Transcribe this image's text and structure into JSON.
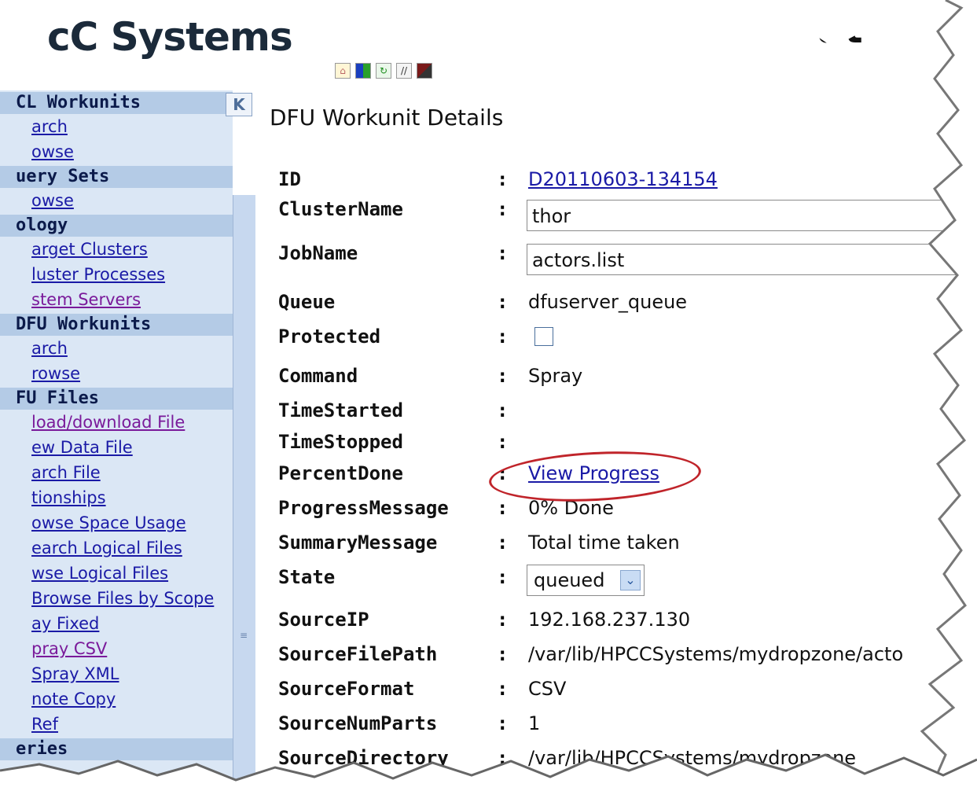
{
  "header": {
    "logo_text": "cC Systems",
    "logo_right_text": "at",
    "toolbar_icons": [
      "home-icon",
      "color-grid-icon",
      "refresh-icon",
      "edit-icon",
      "windows-icon"
    ]
  },
  "sidebar": {
    "collapse_label": "K",
    "sections": [
      {
        "title": "CL Workunits",
        "items": [
          {
            "label": "arch"
          },
          {
            "label": "owse"
          }
        ]
      },
      {
        "title": "uery Sets",
        "items": [
          {
            "label": "owse"
          }
        ]
      },
      {
        "title": "ology",
        "items": [
          {
            "label": "arget Clusters"
          },
          {
            "label": "luster Processes"
          },
          {
            "label": "stem Servers",
            "visited": true
          }
        ]
      },
      {
        "title": "DFU Workunits",
        "items": [
          {
            "label": "arch"
          },
          {
            "label": "rowse"
          }
        ]
      },
      {
        "title": "FU Files",
        "items": [
          {
            "label": "load/download File",
            "visited": true
          },
          {
            "label": "ew Data File"
          },
          {
            "label": "arch File"
          },
          {
            "label": "tionships"
          },
          {
            "label": "owse Space Usage"
          },
          {
            "label": "earch Logical Files"
          },
          {
            "label": "wse Logical Files"
          },
          {
            "label": "Browse Files by Scope"
          },
          {
            "label": "ay Fixed"
          },
          {
            "label": "pray CSV",
            "visited": true
          },
          {
            "label": "Spray XML"
          },
          {
            "label": "note Copy"
          },
          {
            "label": "Ref"
          }
        ]
      },
      {
        "title": "eries",
        "items": []
      }
    ]
  },
  "main": {
    "title": "DFU Workunit Details",
    "fields": [
      {
        "label": "ID",
        "value": "D20110603-134154",
        "kind": "link"
      },
      {
        "label": "ClusterName",
        "value": "thor",
        "kind": "textbox"
      },
      {
        "label": "JobName",
        "value": "actors.list",
        "kind": "textbox"
      },
      {
        "label": "Queue",
        "value": "dfuserver_queue",
        "kind": "text"
      },
      {
        "label": "Protected",
        "value": "",
        "kind": "checkbox"
      },
      {
        "label": "Command",
        "value": "Spray",
        "kind": "text"
      },
      {
        "label": "TimeStarted",
        "value": "",
        "kind": "text"
      },
      {
        "label": "TimeStopped",
        "value": "",
        "kind": "text"
      },
      {
        "label": "PercentDone",
        "value": "View Progress",
        "kind": "link"
      },
      {
        "label": "ProgressMessage",
        "value": "0% Done",
        "kind": "text"
      },
      {
        "label": "SummaryMessage",
        "value": "Total time taken",
        "kind": "text"
      },
      {
        "label": "State",
        "value": "queued",
        "kind": "select"
      },
      {
        "label": "SourceIP",
        "value": "192.168.237.130",
        "kind": "text"
      },
      {
        "label": "SourceFilePath",
        "value": "/var/lib/HPCCSystems/mydropzone/acto",
        "kind": "text"
      },
      {
        "label": "SourceFormat",
        "value": "CSV",
        "kind": "text"
      },
      {
        "label": "SourceNumParts",
        "value": "1",
        "kind": "text"
      },
      {
        "label": "SourceDirectory",
        "value": "/var/lib/HPCCSystems/mydropzone",
        "kind": "text"
      }
    ],
    "colon": ":"
  },
  "colors": {
    "sidebar_bg": "#dbe7f5",
    "sidebar_header_bg": "#b4cbe6",
    "link": "#1a1aa6",
    "visited_link": "#7a1a9a",
    "highlight_ellipse": "#c0242a"
  }
}
